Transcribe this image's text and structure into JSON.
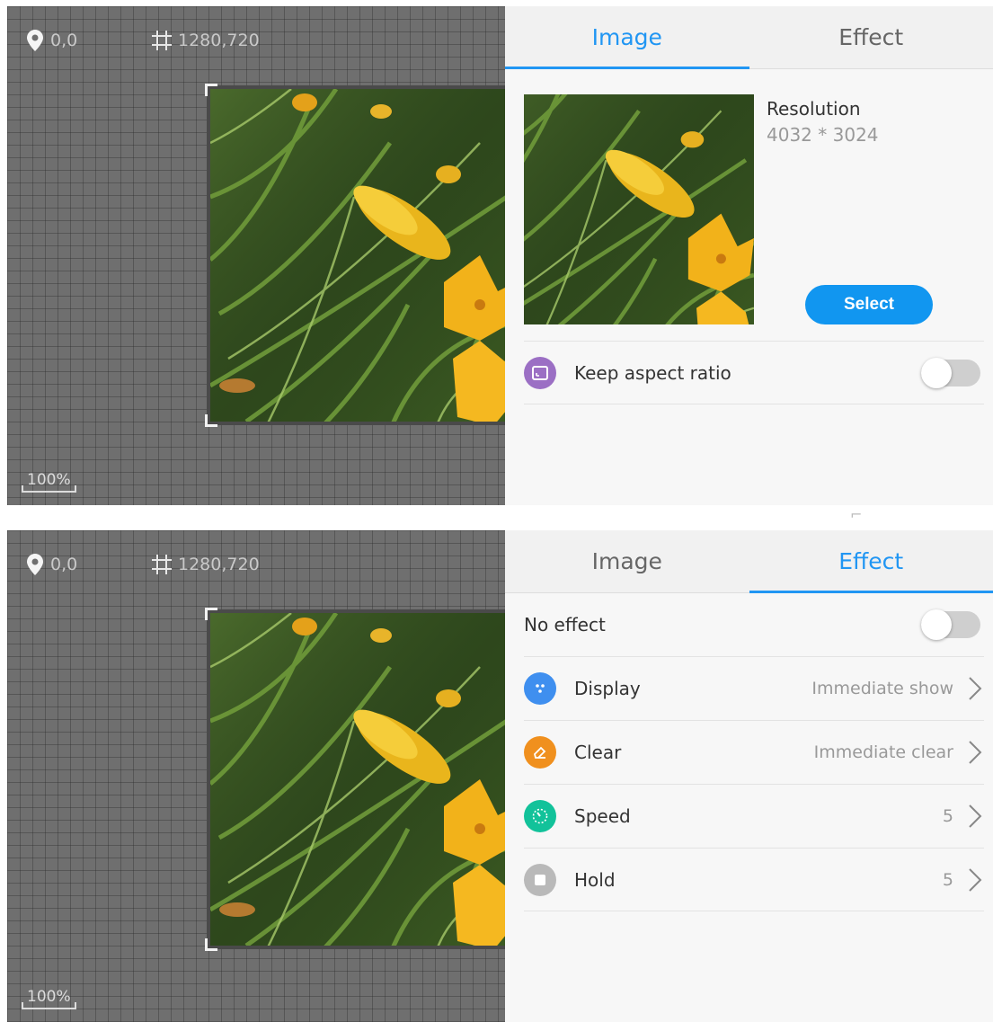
{
  "canvas": {
    "position": "0,0",
    "resolution": "1280,720",
    "zoom": "100%"
  },
  "tabs": {
    "image": "Image",
    "effect": "Effect"
  },
  "image_panel": {
    "resolution_label": "Resolution",
    "resolution_value": "4032 * 3024",
    "select_label": "Select",
    "keep_aspect_label": "Keep aspect ratio",
    "keep_aspect_on": false
  },
  "effect_panel": {
    "no_effect_label": "No effect",
    "no_effect_on": false,
    "rows": [
      {
        "label": "Display",
        "value": "Immediate show",
        "icon": "display-icon",
        "color": "#3f8fef"
      },
      {
        "label": "Clear",
        "value": "Immediate clear",
        "icon": "eraser-icon",
        "color": "#f0901e"
      },
      {
        "label": "Speed",
        "value": "5",
        "icon": "speedometer-icon",
        "color": "#12c29a"
      },
      {
        "label": "Hold",
        "value": "5",
        "icon": "stop-icon",
        "color": "#b9b9b9"
      }
    ]
  },
  "colors": {
    "accent": "#2196f3",
    "button": "#1196f0",
    "canvas_bg": "#6f6f6f"
  }
}
